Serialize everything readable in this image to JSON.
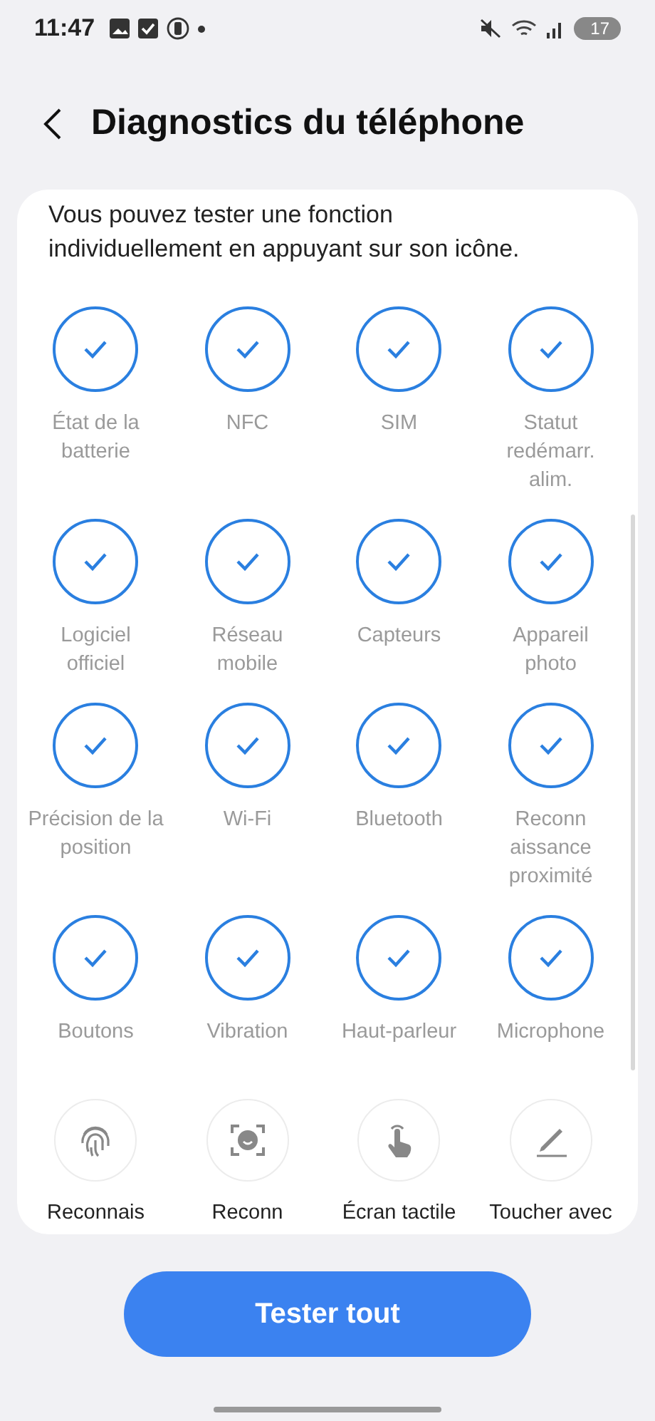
{
  "status_bar": {
    "time": "11:47",
    "battery": "17"
  },
  "header": {
    "title": "Diagnostics du téléphone"
  },
  "intro": "Vous pouvez tester une fonction individuellement en appuyant sur son icône.",
  "tests": [
    {
      "label": "État de la\nbatterie",
      "tested": true
    },
    {
      "label": "NFC",
      "tested": true
    },
    {
      "label": "SIM",
      "tested": true
    },
    {
      "label": "Statut\nredémarr.\nalim.",
      "tested": true
    },
    {
      "label": "Logiciel\nofficiel",
      "tested": true
    },
    {
      "label": "Réseau\nmobile",
      "tested": true
    },
    {
      "label": "Capteurs",
      "tested": true
    },
    {
      "label": "Appareil\nphoto",
      "tested": true
    },
    {
      "label": "Précision de la\nposition",
      "tested": true
    },
    {
      "label": "Wi-Fi",
      "tested": true
    },
    {
      "label": "Bluetooth",
      "tested": true
    },
    {
      "label": "Reconn\naissance\nproximité",
      "tested": true
    },
    {
      "label": "Boutons",
      "tested": true
    },
    {
      "label": "Vibration",
      "tested": true
    },
    {
      "label": "Haut-parleur",
      "tested": true
    },
    {
      "label": "Microphone",
      "tested": true
    },
    {
      "label": "Reconnais",
      "tested": false
    },
    {
      "label": "Reconn",
      "tested": false
    },
    {
      "label": "Écran tactile",
      "tested": false
    },
    {
      "label": "Toucher avec",
      "tested": false
    }
  ],
  "button": "Tester tout"
}
